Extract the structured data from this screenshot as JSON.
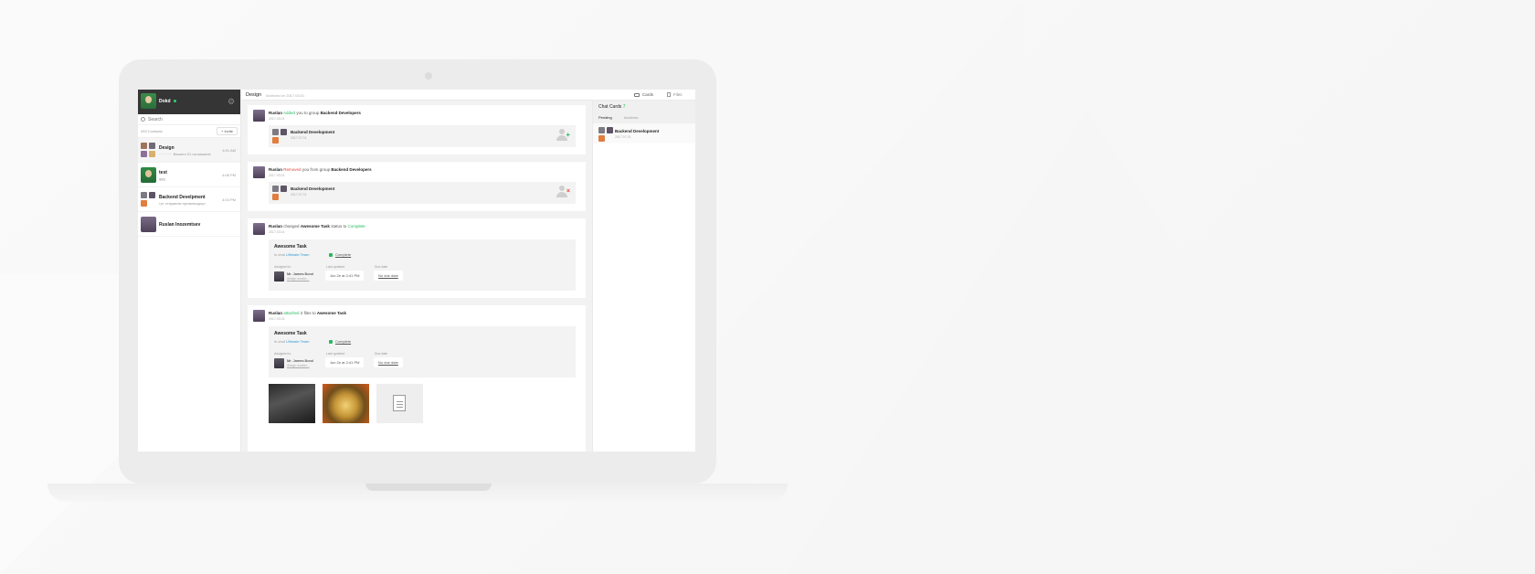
{
  "colors": {
    "accent_green": "#2bb860",
    "removed_red": "#e0463b",
    "link_blue": "#3399d6",
    "sidebar_header": "#353535"
  },
  "sidebar": {
    "user_name": "Dokd",
    "search_placeholder": "Search",
    "contacts_count": "263 Contacts",
    "invite_label": "Invite",
    "items": [
      {
        "title": "Design",
        "subtitle": "··········· Вашего 01 на машине",
        "time": "4:01 AM"
      },
      {
        "title": "test",
        "subtitle": "ggg",
        "time": "4:08 PM"
      },
      {
        "title": "Backend Develpment",
        "subtitle": "тут отправлю премиюодоут",
        "time": "4:04 PM"
      },
      {
        "title": "Ruslan Inozemtsev",
        "subtitle": "",
        "time": ""
      }
    ]
  },
  "main": {
    "title": "Design",
    "subtitle": "Archived on 2017.03.01",
    "events": [
      {
        "actor": "Ruslan",
        "action": "Added",
        "middle": "you to group",
        "target": "Backend Developers",
        "date": "2017.03.01",
        "group_title": "Backend Development",
        "group_date": "2017.07.01"
      },
      {
        "actor": "Ruslan",
        "action": "Removed",
        "middle": "you from group",
        "target": "Backend Developers",
        "date": "2017.03.01",
        "group_title": "Backend Development",
        "group_date": "2017.07.01"
      },
      {
        "actor": "Ruslan",
        "middle": "changed",
        "target": "Awesome Task",
        "middle2": "status to",
        "action": "Complete",
        "date": "2017.03.01"
      },
      {
        "actor": "Ruslan",
        "action": "attached",
        "middle": "2 files to",
        "target": "Awesome Task",
        "date": "2017.03.01"
      }
    ],
    "task": {
      "title": "Awesome Task",
      "chat_prefix": "in chat",
      "chat_name": "Ultimate Team",
      "status": "Complete",
      "assigned_label": "Assigned to",
      "assignee_name": "Mr. James Bond",
      "assignee_sub": "design worker...",
      "updated_label": "Last updated",
      "updated_value": "Jun 2e at 2:41 PM",
      "due_label": "Due date",
      "due_value": "No due date"
    }
  },
  "topbar": {
    "cards_label": "Cards",
    "files_label": "Files"
  },
  "right_panel": {
    "title": "Chat Cards",
    "count": "7",
    "tab_pending": "Pending",
    "tab_archives": "Archives",
    "item_title": "Backend Development",
    "item_date": "2017.07.01"
  }
}
